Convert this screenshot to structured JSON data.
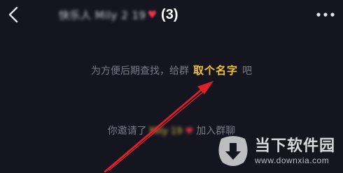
{
  "header": {
    "back_icon": "chevron-left-icon",
    "title_obscured": "快乐人 Mily 2 19",
    "title_count": "(3)",
    "more_icon": "more-dots-icon"
  },
  "messages": {
    "rename_prefix": "为方便后期查找，给群",
    "rename_link": "取个名字",
    "rename_suffix": "吧",
    "invite_prefix": "你邀请了",
    "invitee_obscured": "Mily 19",
    "invite_suffix": "加入群聊"
  },
  "annotation": {
    "arrow_color": "#e0202a"
  },
  "watermark": {
    "brand": "当下软件园",
    "url": "www.downxia.com"
  },
  "colors": {
    "background": "#15151f",
    "highlight": "#f0c236",
    "muted": "#7b7b88"
  }
}
